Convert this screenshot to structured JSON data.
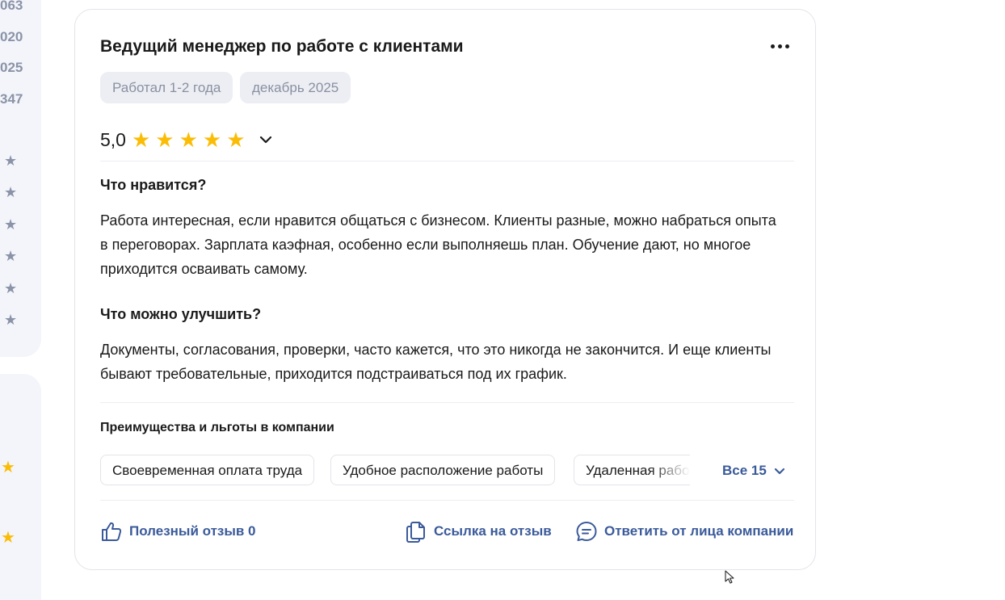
{
  "sidebar": {
    "numbers": [
      "063",
      "020",
      "025",
      "347"
    ],
    "star_icon": "star-icon"
  },
  "review": {
    "title": "Ведущий менеджер по работе с клиентами",
    "tags": [
      "Работал 1-2 года",
      "декабрь 2025"
    ],
    "rating": "5,0",
    "stars": 5,
    "likes_heading": "Что нравится?",
    "likes_text": "Работа интересная, если нравится общаться с бизнесом. Клиенты разные, можно набраться опыта в переговорах. Зарплата каэфная, особенно если выполняешь план. Обучение дают, но многое приходится осваивать самому.",
    "improve_heading": "Что можно улучшить?",
    "improve_text": "Документы, согласования, проверки, часто кажется, что это никогда не закончится. И еще клиенты бывают требовательные, приходится подстраиваться под их график.",
    "benefits_title": "Преимущества и льготы в компании",
    "benefits": [
      "Своевременная оплата труда",
      "Удобное расположение работы",
      "Удаленная работа"
    ],
    "benefits_all": "Все 15",
    "actions": {
      "useful": "Полезный отзыв 0",
      "link": "Ссылка на отзыв",
      "reply": "Ответить от лица компании"
    }
  },
  "colors": {
    "accent": "#3a5a9a",
    "star": "#fbbc05",
    "tag_bg": "#eceef4",
    "sidebar_bg": "#f4f5fa"
  }
}
